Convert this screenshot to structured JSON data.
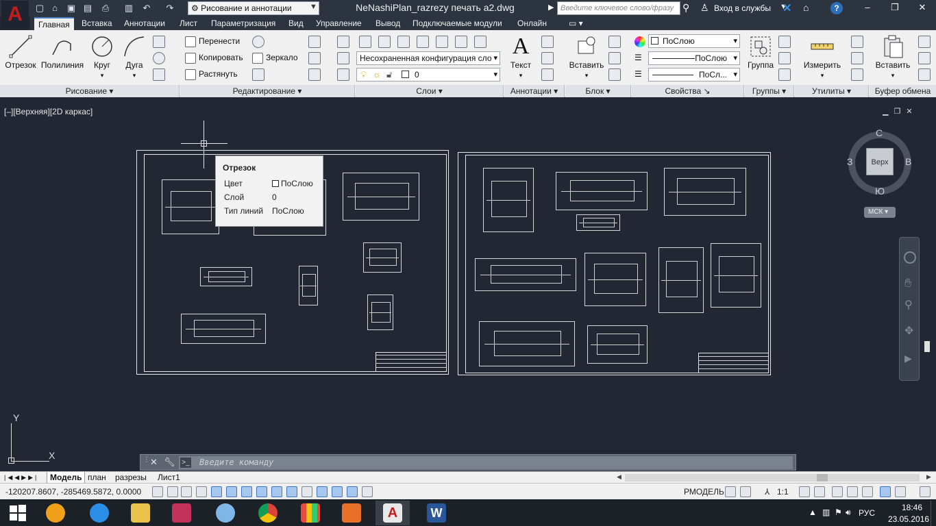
{
  "titlebar": {
    "workspace": "Рисование и аннотации",
    "document_title": "NeNashiPlan_razrezy печать а2.dwg",
    "search_placeholder": "Введите ключевое слово/фразу",
    "login": "Вход в службы",
    "help": "?"
  },
  "menu_tabs": [
    "Главная",
    "Вставка",
    "Аннотации",
    "Лист",
    "Параметризация",
    "Вид",
    "Управление",
    "Вывод",
    "Подключаемые модули",
    "Онлайн"
  ],
  "ribbon": {
    "draw": {
      "line": "Отрезок",
      "polyline": "Полилиния",
      "circle": "Круг",
      "arc": "Дуга",
      "panel": "Рисование"
    },
    "modify": {
      "move": "Перенести",
      "copy": "Копировать",
      "mirror": "Зеркало",
      "stretch": "Растянуть",
      "panel": "Редактирование"
    },
    "layers": {
      "state": "Несохраненная конфигурация сло",
      "current": "0",
      "panel": "Слои"
    },
    "annotation": {
      "text": "Текст",
      "panel": "Аннотации"
    },
    "block": {
      "insert": "Вставить",
      "panel": "Блок"
    },
    "properties": {
      "color": "ПоСлою",
      "linetype": "ПоСлою",
      "lineweight": "ПоСл...",
      "panel": "Свойства"
    },
    "groups": {
      "group": "Группа",
      "panel": "Группы"
    },
    "utilities": {
      "measure": "Измерить",
      "panel": "Утилиты"
    },
    "clipboard": {
      "paste": "Вставить",
      "panel": "Буфер обмена"
    }
  },
  "viewport_label": "[–][Верхняя][2D каркас]",
  "tooltip": {
    "title": "Отрезок",
    "rows": [
      {
        "key": "Цвет",
        "value": "ПоСлою"
      },
      {
        "key": "Слой",
        "value": "0"
      },
      {
        "key": "Тип линий",
        "value": "ПоСлою"
      }
    ]
  },
  "viewcube": {
    "north": "С",
    "south": "Ю",
    "east": "В",
    "west": "З",
    "face": "Верх",
    "wcs": "МСК"
  },
  "ucs": {
    "x": "X",
    "y": "Y"
  },
  "command_line": {
    "placeholder": "Введите команду"
  },
  "layout_tabs": [
    "Модель",
    "план",
    "разрезы",
    "Лист1"
  ],
  "statusbar": {
    "coords": "-120207.8607, -285469.5872, 0.0000",
    "mode": "РМОДЕЛЬ",
    "scale": "1:1"
  },
  "taskbar": {
    "lang": "РУС",
    "time": "18:46",
    "date": "23.05.2016"
  },
  "colors": {
    "canvas": "#222733",
    "ribbon": "#f0f0f0",
    "titlebar": "#2c3440",
    "accent": "#c21d1d"
  }
}
